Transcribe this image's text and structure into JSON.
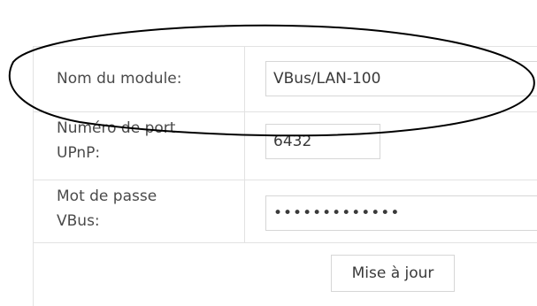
{
  "form": {
    "module_name_label": "Nom du module:",
    "module_name_value": "VBus/LAN-100",
    "upnp_port_label": "Numéro de port\nUPnP:",
    "upnp_port_value": "6432",
    "vbus_password_label": "Mot de passe\nVBus:",
    "vbus_password_value": "•••••••••••••",
    "update_button_label": "Mise à jour"
  },
  "colors": {
    "border": "#e2e2e2",
    "input_border": "#d6d6d6",
    "text": "#4a4a4a",
    "annotation": "#000000"
  }
}
